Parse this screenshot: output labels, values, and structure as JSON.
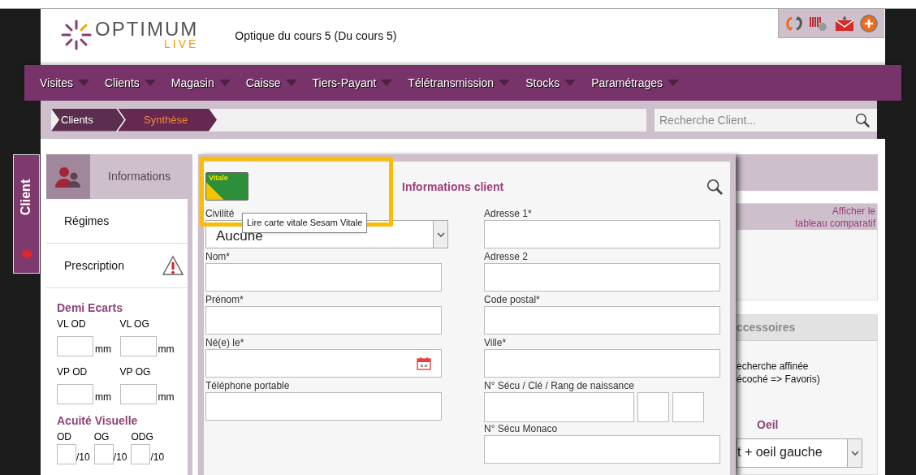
{
  "header": {
    "logo_word": "OPTIMUM",
    "logo_sub": "LIVE",
    "store": "Optique du cours 5 (Du cours 5)"
  },
  "nav": [
    {
      "label": "Visites"
    },
    {
      "label": "Clients"
    },
    {
      "label": "Magasin"
    },
    {
      "label": "Caisse"
    },
    {
      "label": "Tiers-Payant"
    },
    {
      "label": "Télétransmission"
    },
    {
      "label": "Stocks"
    },
    {
      "label": "Paramétrages"
    }
  ],
  "breadcrumb": [
    {
      "label": "Clients",
      "selected": false
    },
    {
      "label": "Synthèse",
      "selected": true
    }
  ],
  "search": {
    "placeholder": "Recherche Client..."
  },
  "side_tab": {
    "label": "Client"
  },
  "sidebar": {
    "items": [
      {
        "label": "Informations",
        "selected": true,
        "warning": false
      },
      {
        "label": "Régimes",
        "selected": false,
        "warning": false
      },
      {
        "label": "Prescription",
        "selected": false,
        "warning": true
      }
    ]
  },
  "demi_ecarts": {
    "title": "Demi Ecarts",
    "fields": [
      {
        "label": "VL OD",
        "unit": "mm"
      },
      {
        "label": "VL OG",
        "unit": "mm"
      },
      {
        "label": "VP OD",
        "unit": "mm"
      },
      {
        "label": "VP OG",
        "unit": "mm"
      }
    ]
  },
  "acuite": {
    "title": "Acuité Visuelle",
    "fields": [
      {
        "label": "OD",
        "unit": "/10"
      },
      {
        "label": "OG",
        "unit": "/10"
      },
      {
        "label": "ODG",
        "unit": "/10"
      }
    ]
  },
  "dialog": {
    "title": "Informations client",
    "card_label": "Vitale",
    "tooltip": "Lire carte vitale Sesam Vitale",
    "left_fields": [
      {
        "label": "Civilité",
        "kind": "select",
        "value": "Aucune"
      },
      {
        "label": "Nom*",
        "kind": "text"
      },
      {
        "label": "Prénom*",
        "kind": "text"
      },
      {
        "label": "Né(e) le*",
        "kind": "date"
      },
      {
        "label": "Téléphone portable",
        "kind": "text"
      }
    ],
    "right_fields": [
      {
        "label": "Adresse 1*",
        "kind": "text"
      },
      {
        "label": "Adresse 2",
        "kind": "text"
      },
      {
        "label": "Code postal*",
        "kind": "text"
      },
      {
        "label": "Ville*",
        "kind": "text"
      },
      {
        "label": "N° Sécu / Clé / Rang de naissance",
        "kind": "triple"
      },
      {
        "label": "N° Sécu Monaco",
        "kind": "text"
      }
    ]
  },
  "right_panel": {
    "link_lines": [
      "Afficher le",
      "tableau comparatif"
    ],
    "section": "ccessoires",
    "notes": [
      "echerche affinée",
      "écoché => Favoris)"
    ],
    "oeil_label": "Oeil",
    "oeil_value": "t + oeil gauche"
  }
}
